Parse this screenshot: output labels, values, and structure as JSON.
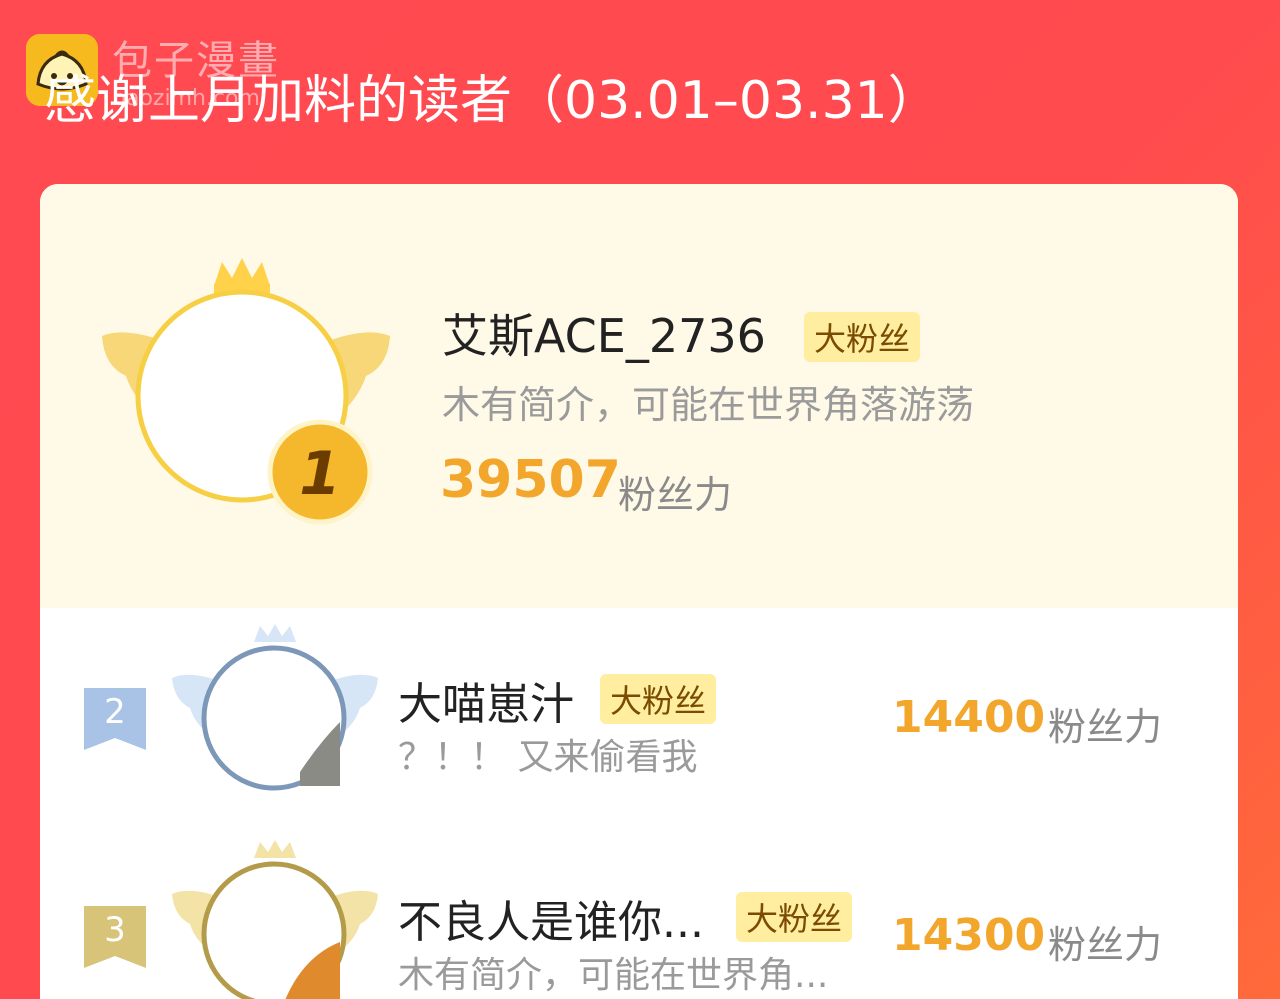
{
  "watermark": {
    "brand": "包子漫畫",
    "url": "baozimh.com",
    "icon": "bun-logo-icon"
  },
  "title": "感谢上月加料的读者（03.01–03.31）",
  "top_reader": {
    "rank": "1",
    "name": "艾斯ACE_2736",
    "badge": "大粉丝",
    "bio": "木有简介，可能在世界角落游荡",
    "score": "39507",
    "unit": "粉丝力"
  },
  "readers": [
    {
      "rank": "2",
      "name": "大喵崽汁",
      "badge": "大粉丝",
      "bio": "？！！ 又来偷看我",
      "score": "14400",
      "unit": "粉丝力"
    },
    {
      "rank": "3",
      "name": "不良人是谁你...",
      "badge": "大粉丝",
      "bio": "木有简介，可能在世界角...",
      "score": "14300",
      "unit": "粉丝力"
    }
  ],
  "colors": {
    "background": "#ff4a4e",
    "gold": "#f3a62c",
    "silver": "#7d97b8",
    "bronze": "#b39b4a"
  }
}
